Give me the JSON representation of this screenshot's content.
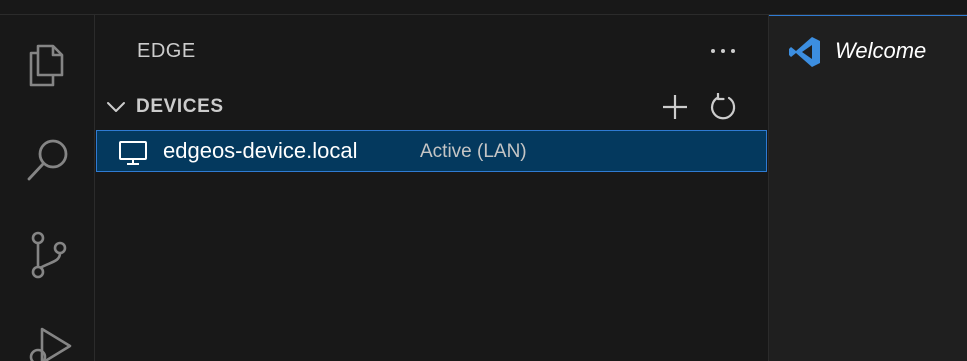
{
  "sidebar": {
    "title": "EDGE",
    "more_actions_icon": "ellipsis-icon",
    "section": {
      "title": "DEVICES",
      "expanded": true,
      "actions": [
        "add-icon",
        "refresh-icon"
      ]
    },
    "devices": [
      {
        "name": "edgeos-device.local",
        "status": "Active (LAN)",
        "icon": "monitor-icon",
        "selected": true
      }
    ]
  },
  "activity_bar": {
    "items": [
      "explorer-icon",
      "search-icon",
      "source-control-icon",
      "run-debug-icon"
    ]
  },
  "editor": {
    "tabs": [
      {
        "label": "Welcome",
        "icon": "vscode-icon",
        "active": true
      }
    ]
  },
  "colors": {
    "background": "#181818",
    "selection": "#04395e",
    "focus_border": "#2f7bd3",
    "accent_blue": "#3c8ee0"
  }
}
